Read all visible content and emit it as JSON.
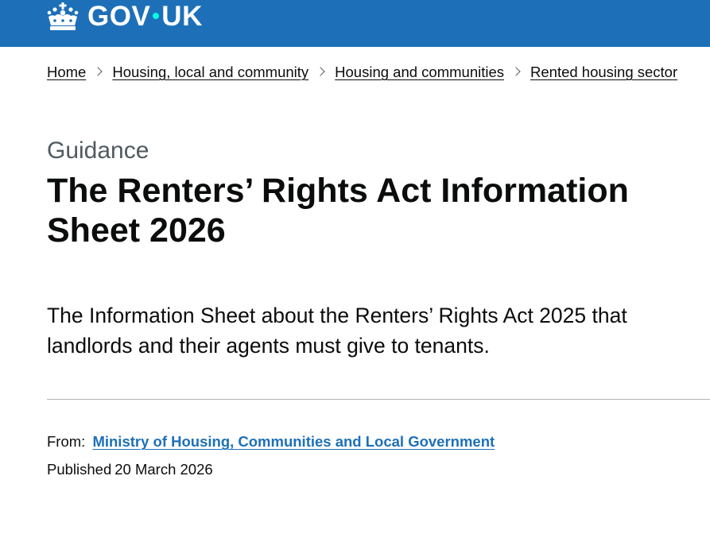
{
  "header": {
    "logo_text_left": "GOV",
    "logo_text_right": "UK",
    "logo_icon": "crown-icon",
    "colors": {
      "background": "#1d70b8",
      "dot": "#00ffe0"
    }
  },
  "breadcrumbs": [
    {
      "label": "Home"
    },
    {
      "label": "Housing, local and community"
    },
    {
      "label": "Housing and communities"
    },
    {
      "label": "Rented housing sector"
    }
  ],
  "page": {
    "caption": "Guidance",
    "title": "The Renters’ Rights Act Information Sheet 2026",
    "lead": "The Information Sheet about the Renters’ Rights Act 2025 that landlords and their agents must give to tenants."
  },
  "metadata": {
    "from_label": "From:",
    "organisation": "Ministry of Housing, Communities and Local Government",
    "published_label": "Published",
    "published_date": "20 March 2026"
  },
  "colors": {
    "text": "#0b0c0c",
    "secondary_text": "#505a5f",
    "link": "#1d70b8",
    "divider": "#b1b4b6"
  }
}
